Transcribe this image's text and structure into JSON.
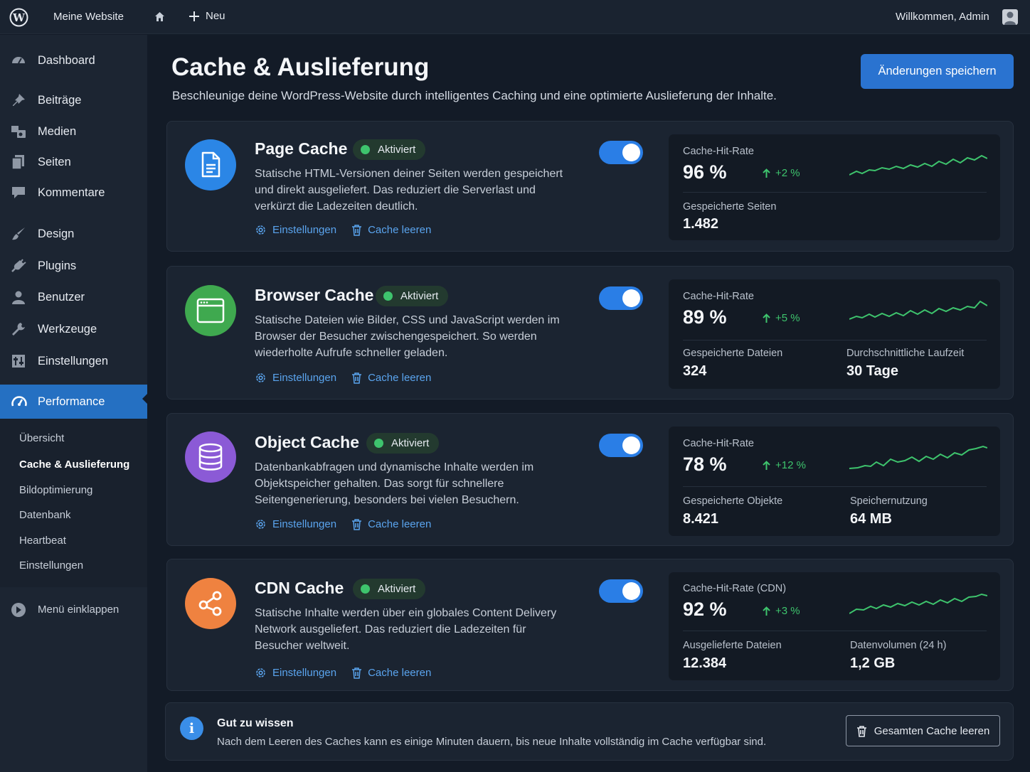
{
  "topbar": {
    "site_name": "Meine Website",
    "new_label": "Neu",
    "welcome": "Willkommen, Admin"
  },
  "sidebar": {
    "items": [
      {
        "label": "Dashboard",
        "icon": "dashboard-icon"
      },
      {
        "label": "Beiträge",
        "icon": "pin-icon"
      },
      {
        "label": "Medien",
        "icon": "media-icon"
      },
      {
        "label": "Seiten",
        "icon": "pages-icon"
      },
      {
        "label": "Kommentare",
        "icon": "comment-icon"
      },
      {
        "label": "Design",
        "icon": "brush-icon"
      },
      {
        "label": "Plugins",
        "icon": "plug-icon"
      },
      {
        "label": "Benutzer",
        "icon": "user-icon"
      },
      {
        "label": "Werkzeuge",
        "icon": "wrench-icon"
      },
      {
        "label": "Einstellungen",
        "icon": "settings-icon"
      },
      {
        "label": "Performance",
        "icon": "gauge-icon"
      }
    ],
    "submenu": [
      "Übersicht",
      "Cache & Auslieferung",
      "Bildoptimierung",
      "Datenbank",
      "Heartbeat",
      "Einstellungen"
    ],
    "submenu_current": "Cache & Auslieferung",
    "collapse_label": "Menü einklappen"
  },
  "page": {
    "title": "Cache & Auslieferung",
    "subtitle": "Beschleunige deine WordPress-Website durch intelligentes Caching und eine optimierte Auslieferung der Inhalte.",
    "save_label": "Änderungen speichern"
  },
  "cards": [
    {
      "title": "Page Cache",
      "badge": "Aktiviert",
      "desc": "Statische HTML-Versionen deiner Seiten werden gespeichert und direkt ausgeliefert. Das reduziert die Serverlast und verkürzt die Ladezeiten deutlich.",
      "link_settings": "Einstellungen",
      "link_clear": "Cache leeren",
      "enabled": true,
      "icon": "document-icon",
      "color": "#2b86e6",
      "stat_label": "Cache-Hit-Rate",
      "stat_value": "96 %",
      "stat_delta": "+2 %",
      "sub_stats": [
        {
          "label": "Gespeicherte Seiten",
          "value": "1.482"
        }
      ]
    },
    {
      "title": "Browser Cache",
      "badge": "Aktiviert",
      "desc": "Statische Dateien wie Bilder, CSS und JavaScript werden im Browser der Besucher zwischengespeichert. So werden wiederholte Aufrufe schneller geladen.",
      "link_settings": "Einstellungen",
      "link_clear": "Cache leeren",
      "enabled": true,
      "icon": "browser-window-icon",
      "color": "#3fa94f",
      "stat_label": "Cache-Hit-Rate",
      "stat_value": "89 %",
      "stat_delta": "+5 %",
      "sub_stats": [
        {
          "label": "Gespeicherte Dateien",
          "value": "324"
        },
        {
          "label": "Durchschnittliche Laufzeit",
          "value": "30 Tage"
        }
      ]
    },
    {
      "title": "Object Cache",
      "badge": "Aktiviert",
      "desc": "Datenbankabfragen und dynamische Inhalte werden im Objektspeicher gehalten. Das sorgt für schnellere Seitengenerierung, besonders bei vielen Besuchern.",
      "link_settings": "Einstellungen",
      "link_clear": "Cache leeren",
      "enabled": true,
      "icon": "database-icon",
      "color": "#8b5ad6",
      "stat_label": "Cache-Hit-Rate",
      "stat_value": "78 %",
      "stat_delta": "+12 %",
      "sub_stats": [
        {
          "label": "Gespeicherte Objekte",
          "value": "8.421"
        },
        {
          "label": "Speichernutzung",
          "value": "64 MB"
        }
      ]
    },
    {
      "title": "CDN Cache",
      "badge": "Aktiviert",
      "desc": "Statische Inhalte werden über ein globales Content Delivery Network ausgeliefert. Das reduziert die Ladezeiten für Besucher weltweit.",
      "link_settings": "Einstellungen",
      "link_clear": "Cache leeren",
      "enabled": true,
      "icon": "share-network-icon",
      "color": "#ef8240",
      "stat_label": "Cache-Hit-Rate (CDN)",
      "stat_value": "92 %",
      "stat_delta": "+3 %",
      "sub_stats": [
        {
          "label": "Ausgelieferte Dateien",
          "value": "12.384"
        },
        {
          "label": "Datenvolumen (24 h)",
          "value": "1,2 GB"
        }
      ]
    }
  ],
  "info": {
    "title": "Gut zu wissen",
    "text": "Nach dem Leeren des Caches kann es einige Minuten dauern, bis neue Inhalte vollständig im Cache verfügbar sind.",
    "button": "Gesamten Cache leeren"
  },
  "colors": {
    "accent": "#2a73d0",
    "success": "#3ec46d",
    "link": "#5aa4ee"
  }
}
